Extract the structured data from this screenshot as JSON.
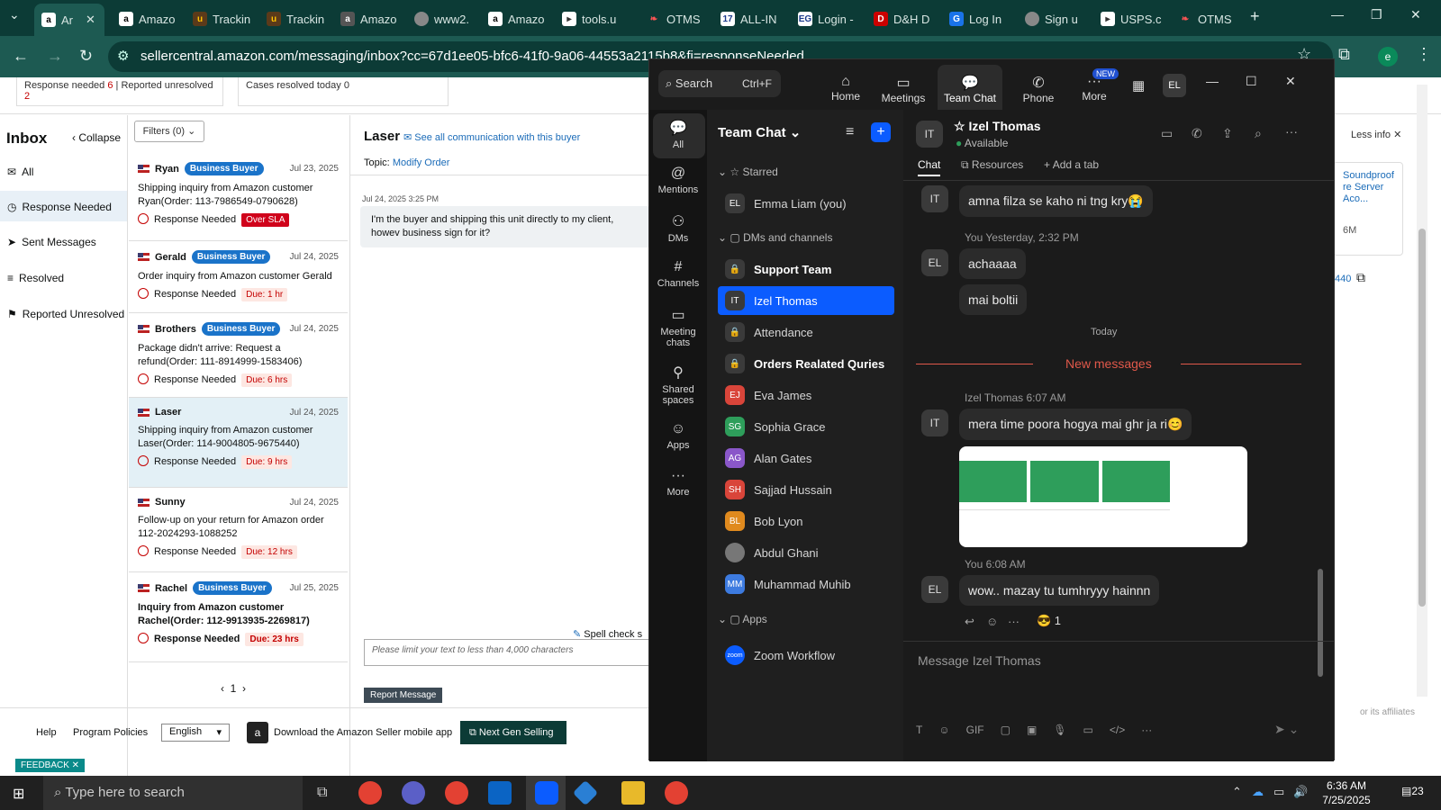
{
  "browser": {
    "tabs": [
      {
        "label": "Ar",
        "icon": "amazon-icon"
      },
      {
        "label": "Amazo",
        "icon": "amazon-icon"
      },
      {
        "label": "Trackin",
        "icon": "ups-icon"
      },
      {
        "label": "Trackin",
        "icon": "ups-icon"
      },
      {
        "label": "Amazo",
        "icon": "amazon-icon"
      },
      {
        "label": "www2.",
        "icon": "globe-icon"
      },
      {
        "label": "Amazo",
        "icon": "amazon-icon"
      },
      {
        "label": "tools.u",
        "icon": "usps-icon"
      },
      {
        "label": "OTMS",
        "icon": "otms-icon"
      },
      {
        "label": "ALL-IN",
        "icon": "seventeen-icon"
      },
      {
        "label": "Login -",
        "icon": "eg-icon"
      },
      {
        "label": "D&H D",
        "icon": "dh-icon"
      },
      {
        "label": "Log In",
        "icon": "google-icon"
      },
      {
        "label": "Sign u",
        "icon": "globe-icon"
      },
      {
        "label": "USPS.c",
        "icon": "usps-icon"
      },
      {
        "label": "OTMS",
        "icon": "otms-icon"
      }
    ],
    "url": "sellercentral.amazon.com/messaging/inbox?cc=67d1ee05-bfc6-41f0-9a06-44553a2115b8&fi=responseNeeded"
  },
  "stats": {
    "response_needed": "Response needed",
    "rn_count": "6",
    "reported_unresolved": "Reported unresolved",
    "ru_count": "2",
    "cases_resolved": "Cases resolved today 0"
  },
  "inbox": {
    "title": "Inbox",
    "collapse": "Collapse",
    "filters": "Filters (0)",
    "nav": [
      "All",
      "Response Needed",
      "Sent Messages",
      "Resolved",
      "Reported Unresolved"
    ],
    "messages": [
      {
        "name": "Ryan",
        "badge": "Business Buyer",
        "date": "Jul 23, 2025",
        "subject": "Shipping inquiry from Amazon customer Ryan(Order: 113-7986549-0790628)",
        "status": "Response Needed",
        "due": "Over SLA"
      },
      {
        "name": "Gerald",
        "badge": "Business Buyer",
        "date": "Jul 24, 2025",
        "subject": "Order inquiry from Amazon customer Gerald",
        "status": "Response Needed",
        "due": "Due: 1 hr"
      },
      {
        "name": "Brothers",
        "badge": "Business Buyer",
        "date": "Jul 24, 2025",
        "subject": "Package didn't arrive: Request a refund(Order: 111-8914999-1583406)",
        "status": "Response Needed",
        "due": "Due: 6 hrs"
      },
      {
        "name": "Laser",
        "badge": "",
        "date": "Jul 24, 2025",
        "subject": "Shipping inquiry from Amazon customer Laser(Order: 114-9004805-9675440)",
        "status": "Response Needed",
        "due": "Due: 9 hrs"
      },
      {
        "name": "Sunny",
        "badge": "",
        "date": "Jul 24, 2025",
        "subject": "Follow-up on your return for Amazon order 112-2024293-1088252",
        "status": "Response Needed",
        "due": "Due: 12 hrs"
      },
      {
        "name": "Rachel",
        "badge": "Business Buyer",
        "date": "Jul 25, 2025",
        "subject": "Inquiry from Amazon customer Rachel(Order: 112-9913935-2269817)",
        "status": "Response Needed",
        "due": "Due: 23 hrs"
      }
    ],
    "page": "1"
  },
  "conversation": {
    "buyer": "Laser",
    "see_all": "See all communication with this buyer",
    "topic_label": "Topic:",
    "topic": "Modify Order",
    "timestamp": "Jul 24, 2025 3:25 PM",
    "message": "I'm the buyer and shipping this unit directly to my client, howev business sign for it?",
    "spell": "Spell check s",
    "placeholder": "Please limit your text to less than 4,000 characters",
    "report": "Report Message"
  },
  "right_panel": {
    "less_info": "Less info",
    "product": "Soundproof re Server Aco...",
    "size": "6M",
    "order_tail": "440",
    "affiliates": "or its affiliates"
  },
  "footer": {
    "help": "Help",
    "policies": "Program Policies",
    "language": "English",
    "download": "Download the Amazon Seller mobile app",
    "next_gen": "Next Gen Selling",
    "feedback": "FEEDBACK"
  },
  "zoom": {
    "search": "Search",
    "shortcut": "Ctrl+F",
    "top_nav": [
      "Home",
      "Meetings",
      "Team Chat",
      "Phone",
      "More"
    ],
    "new_badge": "NEW",
    "user_initials": "EL",
    "left_nav": [
      "All",
      "Mentions",
      "DMs",
      "Channels",
      "Meeting chats",
      "Shared spaces",
      "Apps",
      "More"
    ],
    "panel_title": "Team Chat",
    "starred": "Starred",
    "dms_channels": "DMs and channels",
    "apps": "Apps",
    "contacts": [
      {
        "name": "Emma Liam (you)",
        "initials": "EL",
        "color": "#3a3a3a",
        "bold": false
      },
      {
        "name": "Support Team",
        "initials": "",
        "color": "#3a3a3a",
        "bold": true
      },
      {
        "name": "Izel Thomas",
        "initials": "IT",
        "color": "#3a3a3a",
        "bold": false
      },
      {
        "name": "Attendance",
        "initials": "",
        "color": "#3a3a3a",
        "bold": false
      },
      {
        "name": "Orders Realated Quries",
        "initials": "",
        "color": "#3a3a3a",
        "bold": true
      },
      {
        "name": "Eva James",
        "initials": "EJ",
        "color": "#d9453a",
        "bold": false
      },
      {
        "name": "Sophia Grace",
        "initials": "SG",
        "color": "#2e9e5b",
        "bold": false
      },
      {
        "name": "Alan Gates",
        "initials": "AG",
        "color": "#8a57c9",
        "bold": false
      },
      {
        "name": "Sajjad Hussain",
        "initials": "SH",
        "color": "#d9453a",
        "bold": false
      },
      {
        "name": "Bob Lyon",
        "initials": "BL",
        "color": "#e08a1e",
        "bold": false
      },
      {
        "name": "Abdul Ghani",
        "initials": "",
        "color": "#777",
        "bold": false
      },
      {
        "name": "Muhammad Muhib",
        "initials": "MM",
        "color": "#3d7be0",
        "bold": false
      }
    ],
    "app_item": "Zoom Workflow",
    "app_initials": "zoom",
    "chat_name": "Izel Thomas",
    "chat_initials": "IT",
    "status": "Available",
    "tabs": [
      "Chat",
      "Resources",
      "Add a tab"
    ],
    "messages": {
      "m1": "amna filza se kaho ni tng kry😭",
      "you_label1": "You Yesterday, 2:32 PM",
      "m2": "achaaaa",
      "m3": "mai boltii",
      "today": "Today",
      "new_messages": "New messages",
      "izel_label": "Izel Thomas 6:07 AM",
      "m4": "mera time poora hogya mai ghr ja ri😊",
      "you_label2": "You 6:08 AM",
      "m5": "wow.. mazay tu tumhryyy hainnn",
      "reaction": "😎 1"
    },
    "compose_placeholder": "Message Izel Thomas",
    "compose_tools": [
      "T",
      "☺",
      "GIF",
      "▢",
      "▣",
      "🎙",
      "▭",
      "</>",
      "···"
    ]
  },
  "taskbar": {
    "search": "Type here to search",
    "time": "6:36 AM",
    "date": "7/25/2025",
    "notif": "23"
  }
}
